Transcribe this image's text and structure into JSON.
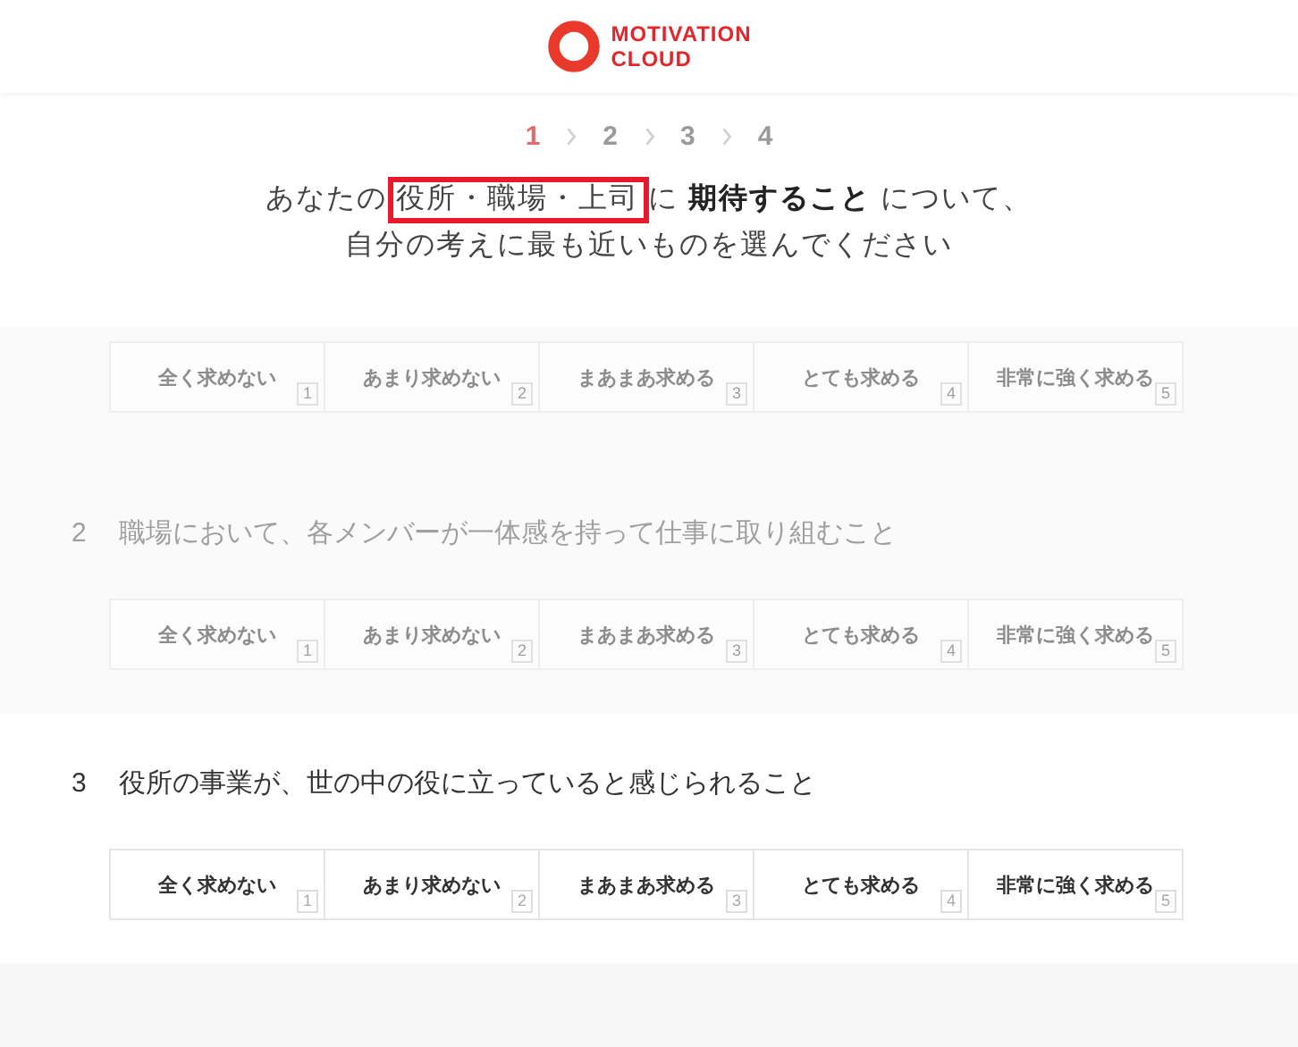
{
  "header": {
    "logo": [
      "MOTIVATION",
      "CLOUD"
    ]
  },
  "steps": [
    {
      "label": "1",
      "selected": true
    },
    {
      "label": "2",
      "selected": false
    },
    {
      "label": "3",
      "selected": false
    },
    {
      "label": "4",
      "selected": false
    }
  ],
  "instruction": {
    "before": "あなたの",
    "highlighted": "役所・職場・上司",
    "after": "に **期待すること** について、",
    "line_2": "自分の考えに最も近いものを選んでください"
  },
  "questions": [
    {
      "faded": true,
      "options": [
        {
          "label": "全く求めない",
          "key": "1"
        },
        {
          "label": "あまり求めない",
          "key": "2"
        },
        {
          "label": "まあまあ求める",
          "key": "3"
        },
        {
          "label": "とても求める",
          "key": "4"
        },
        {
          "label": "非常に強く求める",
          "key": "5"
        }
      ]
    },
    {
      "faded": true,
      "number": "2",
      "text": "職場において、各メンバーが一体感を持って仕事に取り組むこと",
      "options": [
        {
          "label": "全く求めない",
          "key": "1"
        },
        {
          "label": "あまり求めない",
          "key": "2"
        },
        {
          "label": "まあまあ求める",
          "key": "3"
        },
        {
          "label": "とても求める",
          "key": "4"
        },
        {
          "label": "非常に強く求める",
          "key": "5"
        }
      ]
    },
    {
      "faded": false,
      "number": "3",
      "text": "役所の事業が、世の中の役に立っていると感じられること",
      "options": [
        {
          "label": "全く求めない",
          "key": "1"
        },
        {
          "label": "あまり求めない",
          "key": "2"
        },
        {
          "label": "まあまあ求める",
          "key": "3"
        },
        {
          "label": "とても求める",
          "key": "4"
        },
        {
          "label": "非常に強く求める",
          "key": "5"
        }
      ]
    }
  ]
}
